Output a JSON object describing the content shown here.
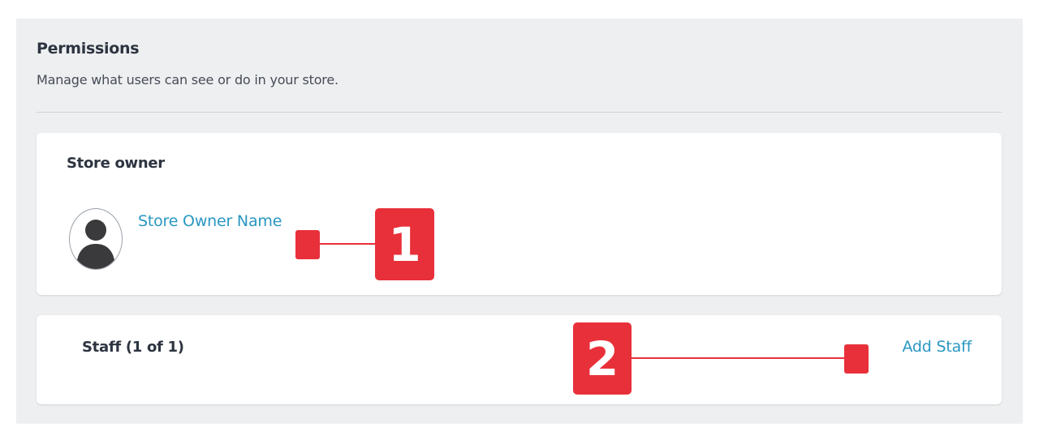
{
  "permissions": {
    "title": "Permissions",
    "description": "Manage what users can see or do in your store."
  },
  "store_owner": {
    "heading": "Store owner",
    "name": "Store Owner Name",
    "avatar_icon": "user-silhouette-icon"
  },
  "staff": {
    "heading": "Staff (1 of 1)",
    "add_label": "Add Staff"
  },
  "callouts": [
    {
      "number": "1",
      "target": "store-owner-name"
    },
    {
      "number": "2",
      "target": "add-staff-link"
    }
  ],
  "colors": {
    "accent": "#e8303a",
    "link": "#2a97c2",
    "panel": "#eeeff1",
    "heading": "#2d3440"
  }
}
